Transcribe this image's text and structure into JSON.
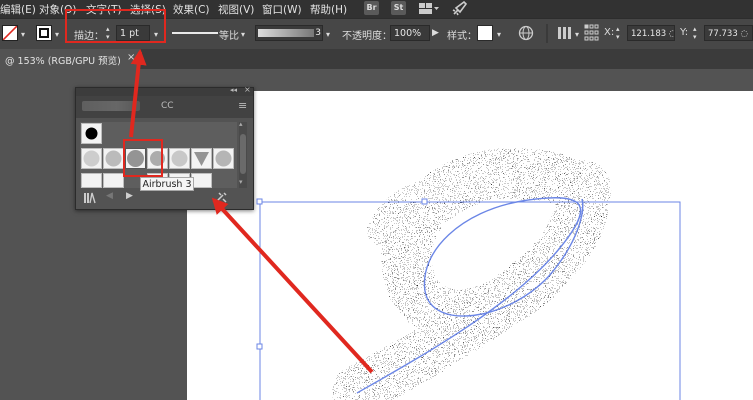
{
  "menu": {
    "items": [
      "编辑(E)",
      "对象(O)",
      "文字(T)",
      "选择(S)",
      "效果(C)",
      "视图(V)",
      "窗口(W)",
      "帮助(H)"
    ],
    "bridge_label": "Br",
    "stock_label": "St"
  },
  "control_bar": {
    "stroke_label": "描边：",
    "stroke_value": "1 pt",
    "profile_label": "等比",
    "brush_size": "3",
    "opacity_label": "不透明度：",
    "opacity_value": "100%",
    "style_label": "样式：",
    "x_label": "X:",
    "x_value": "121.183 ◌",
    "y_label": "Y:",
    "y_value": "77.733 ◌"
  },
  "document_tab": {
    "title": "@ 153% (RGB/GPU 预览)",
    "close": "×"
  },
  "brushes_panel": {
    "title_suffix": "CC",
    "tooltip": "Airbrush 3",
    "collapse": "◂◂",
    "close": "×",
    "menu": "≡"
  },
  "colors": {
    "accent_red": "#e0281f",
    "path_blue": "#6b86e6"
  }
}
